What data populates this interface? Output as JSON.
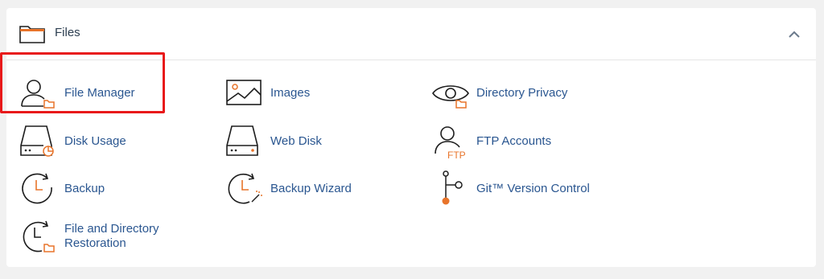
{
  "section": {
    "title": "Files",
    "icon": "folder-icon",
    "collapse_icon": "chevron-up-icon"
  },
  "items": [
    {
      "label": "File Manager",
      "icon": "file-manager-icon"
    },
    {
      "label": "Images",
      "icon": "images-icon"
    },
    {
      "label": "Directory Privacy",
      "icon": "directory-privacy-icon"
    },
    {
      "label": "Disk Usage",
      "icon": "disk-usage-icon"
    },
    {
      "label": "Web Disk",
      "icon": "web-disk-icon"
    },
    {
      "label": "FTP Accounts",
      "icon": "ftp-accounts-icon"
    },
    {
      "label": "Backup",
      "icon": "backup-icon"
    },
    {
      "label": "Backup Wizard",
      "icon": "backup-wizard-icon"
    },
    {
      "label": "Git™ Version Control",
      "icon": "git-icon"
    },
    {
      "label": "File and Directory Restoration",
      "icon": "restoration-icon"
    }
  ],
  "ftp_icon_text": "FTP",
  "colors": {
    "accent": "#e8742a",
    "link": "#2a5690",
    "highlight": "#e8191a"
  }
}
